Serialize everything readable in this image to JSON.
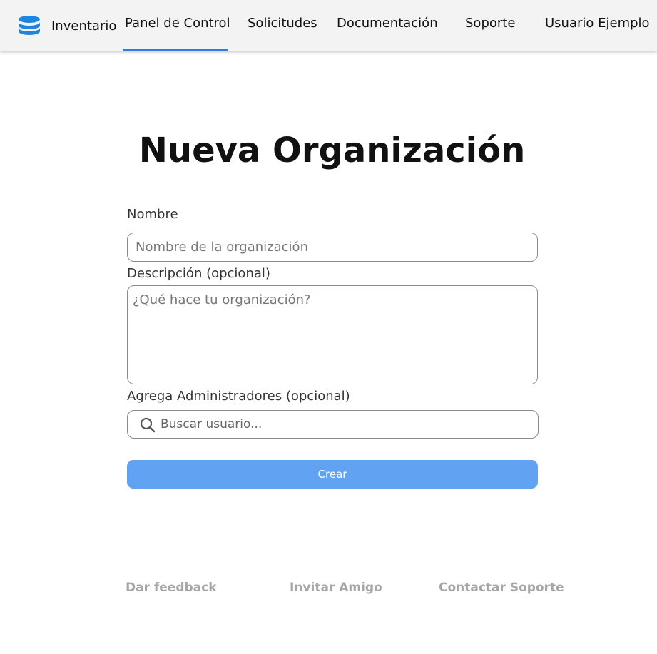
{
  "app": {
    "name": "Inventario"
  },
  "nav": {
    "items": [
      {
        "label": "Panel de Control",
        "active": true
      },
      {
        "label": "Solicitudes",
        "active": false
      },
      {
        "label": "Documentación",
        "active": false
      },
      {
        "label": "Soporte",
        "active": false
      },
      {
        "label": "Usuario Ejemplo",
        "active": false
      }
    ]
  },
  "page": {
    "title": "Nueva Organización"
  },
  "form": {
    "name_label": "Nombre",
    "name_placeholder": "Nombre de la organización",
    "name_value": "",
    "description_label": "Descripción (opcional)",
    "description_placeholder": "¿Qué hace tu organización?",
    "description_value": "",
    "admins_label": "Agrega Administradores (opcional)",
    "admins_search_placeholder": "Buscar usuario...",
    "admins_search_value": "",
    "submit_label": "Crear"
  },
  "footer": {
    "links": [
      {
        "label": "Dar feedback"
      },
      {
        "label": "Invitar Amigo"
      },
      {
        "label": "Contactar Soporte"
      }
    ]
  },
  "icons": {
    "logo": "database-icon",
    "search": "search-icon"
  },
  "colors": {
    "accent": "#2f7ed8",
    "button": "#62a2f3",
    "logo": "#1f86e0",
    "footer_link": "#a6a6a6"
  }
}
